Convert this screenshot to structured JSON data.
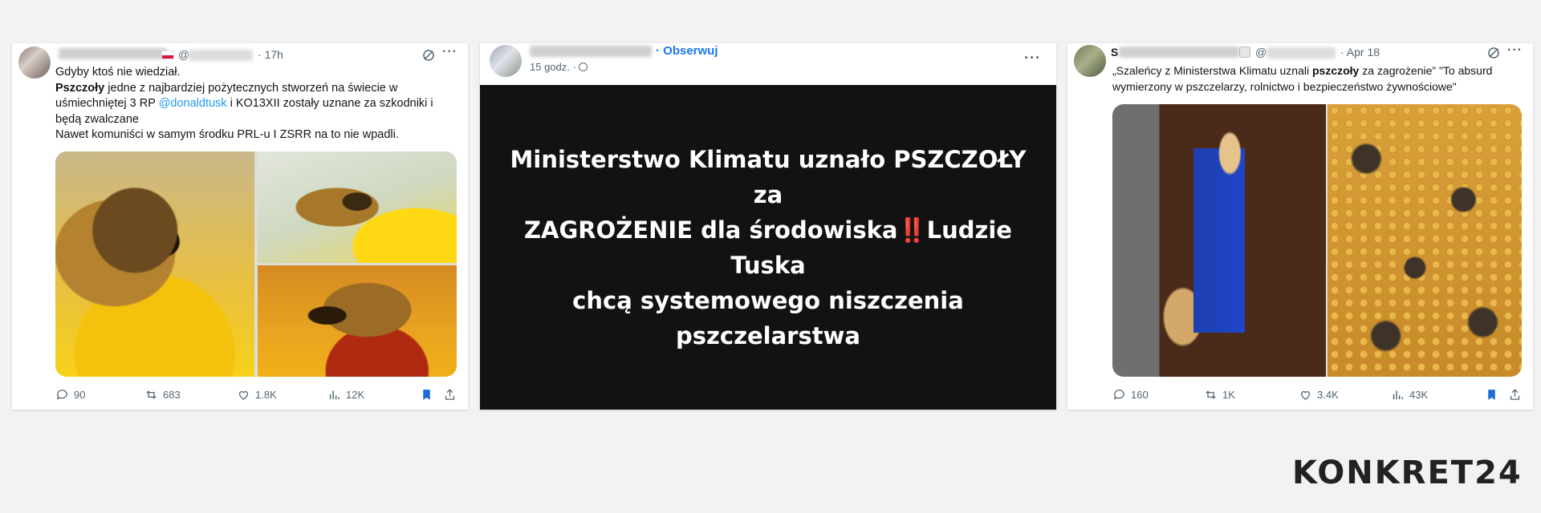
{
  "tweet1": {
    "time": "17h",
    "handle_prefix": "@",
    "lines": {
      "l1": "Gdyby ktoś nie wiedział.",
      "l2_bold": "Pszczoły",
      "l2_rest": " jedne z najbardziej pożytecznych stworzeń na świecie w",
      "l3_a": "uśmiechniętej 3 RP ",
      "l3_mention": "@donaldtusk",
      "l3_b": " i KO13XII zostały uznane za szkodniki i",
      "l4": "będą zwalczane",
      "l5": "Nawet komuniści w samym środku PRL-u I ZSRR na to nie wpadli."
    },
    "replies": "90",
    "reposts": "683",
    "likes": "1.8K",
    "views": "12K"
  },
  "facebook": {
    "follow": "· Obserwuj",
    "time": "15 godz. ·",
    "headline_1": "Ministerstwo Klimatu uznało PSZCZOŁY za",
    "headline_2a": "ZAGROŻENIE dla środowiska",
    "headline_bang": "‼️",
    "headline_2b": "Ludzie Tuska",
    "headline_3": "chcą systemowego niszczenia pszczelarstwa"
  },
  "tweet3": {
    "name_start": "S",
    "handle_prefix": "@",
    "time": "· Apr 18",
    "line1_a": "„Szaleńcy z Ministerstwa Klimatu uznali ",
    "line1_bold": "pszczoły",
    "line1_b": " za zagrożenie” \"To absurd",
    "line2": "wymierzony w pszczelarzy, rolnictwo i bezpieczeństwo żywnościowe\"",
    "replies": "160",
    "reposts": "1K",
    "likes": "3.4K",
    "views": "43K"
  },
  "logo": "KONKRET24",
  "colors": {
    "accent_blue": "#1d9bf0",
    "fb_blue": "#1877f2",
    "bookmark_active": "#1d6bd9",
    "fb_bg": "#121212"
  }
}
